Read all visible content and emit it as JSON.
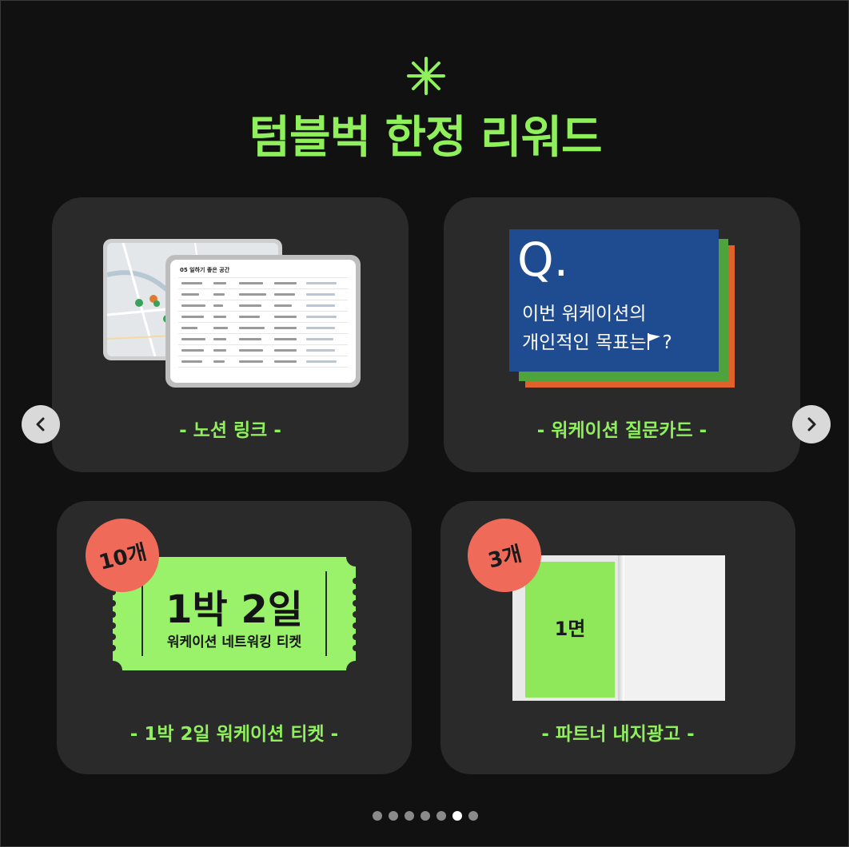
{
  "colors": {
    "accent": "#8ff05c",
    "card": "#2a2a2a",
    "badge": "#f06a5a",
    "question_blue": "#1f4c91",
    "question_green": "#4fa33d",
    "question_orange": "#e0622a"
  },
  "header": {
    "icon": "asterisk-icon",
    "title": "텀블벅 한정 리워드"
  },
  "cards": [
    {
      "caption": "- 노션 링크 -",
      "table_title": "05 일하기 좋은 공간"
    },
    {
      "caption": "- 워케이션 질문카드 -",
      "q": "Q.",
      "line1": "이번 워케이션의",
      "line2": "개인적인 목표는",
      "line2_end": "?",
      "icon": "flag-icon"
    },
    {
      "caption": "- 1박 2일 워케이션 티켓 -",
      "badge": "10개",
      "ticket_title": "1박 2일",
      "ticket_sub": "워케이션 네트워킹 티켓"
    },
    {
      "caption": "- 파트너 내지광고 -",
      "badge": "3개",
      "page_label": "1면"
    }
  ],
  "nav": {
    "prev_icon": "chevron-left-icon",
    "next_icon": "chevron-right-icon"
  },
  "pagination": {
    "count": 7,
    "active_index": 5
  }
}
